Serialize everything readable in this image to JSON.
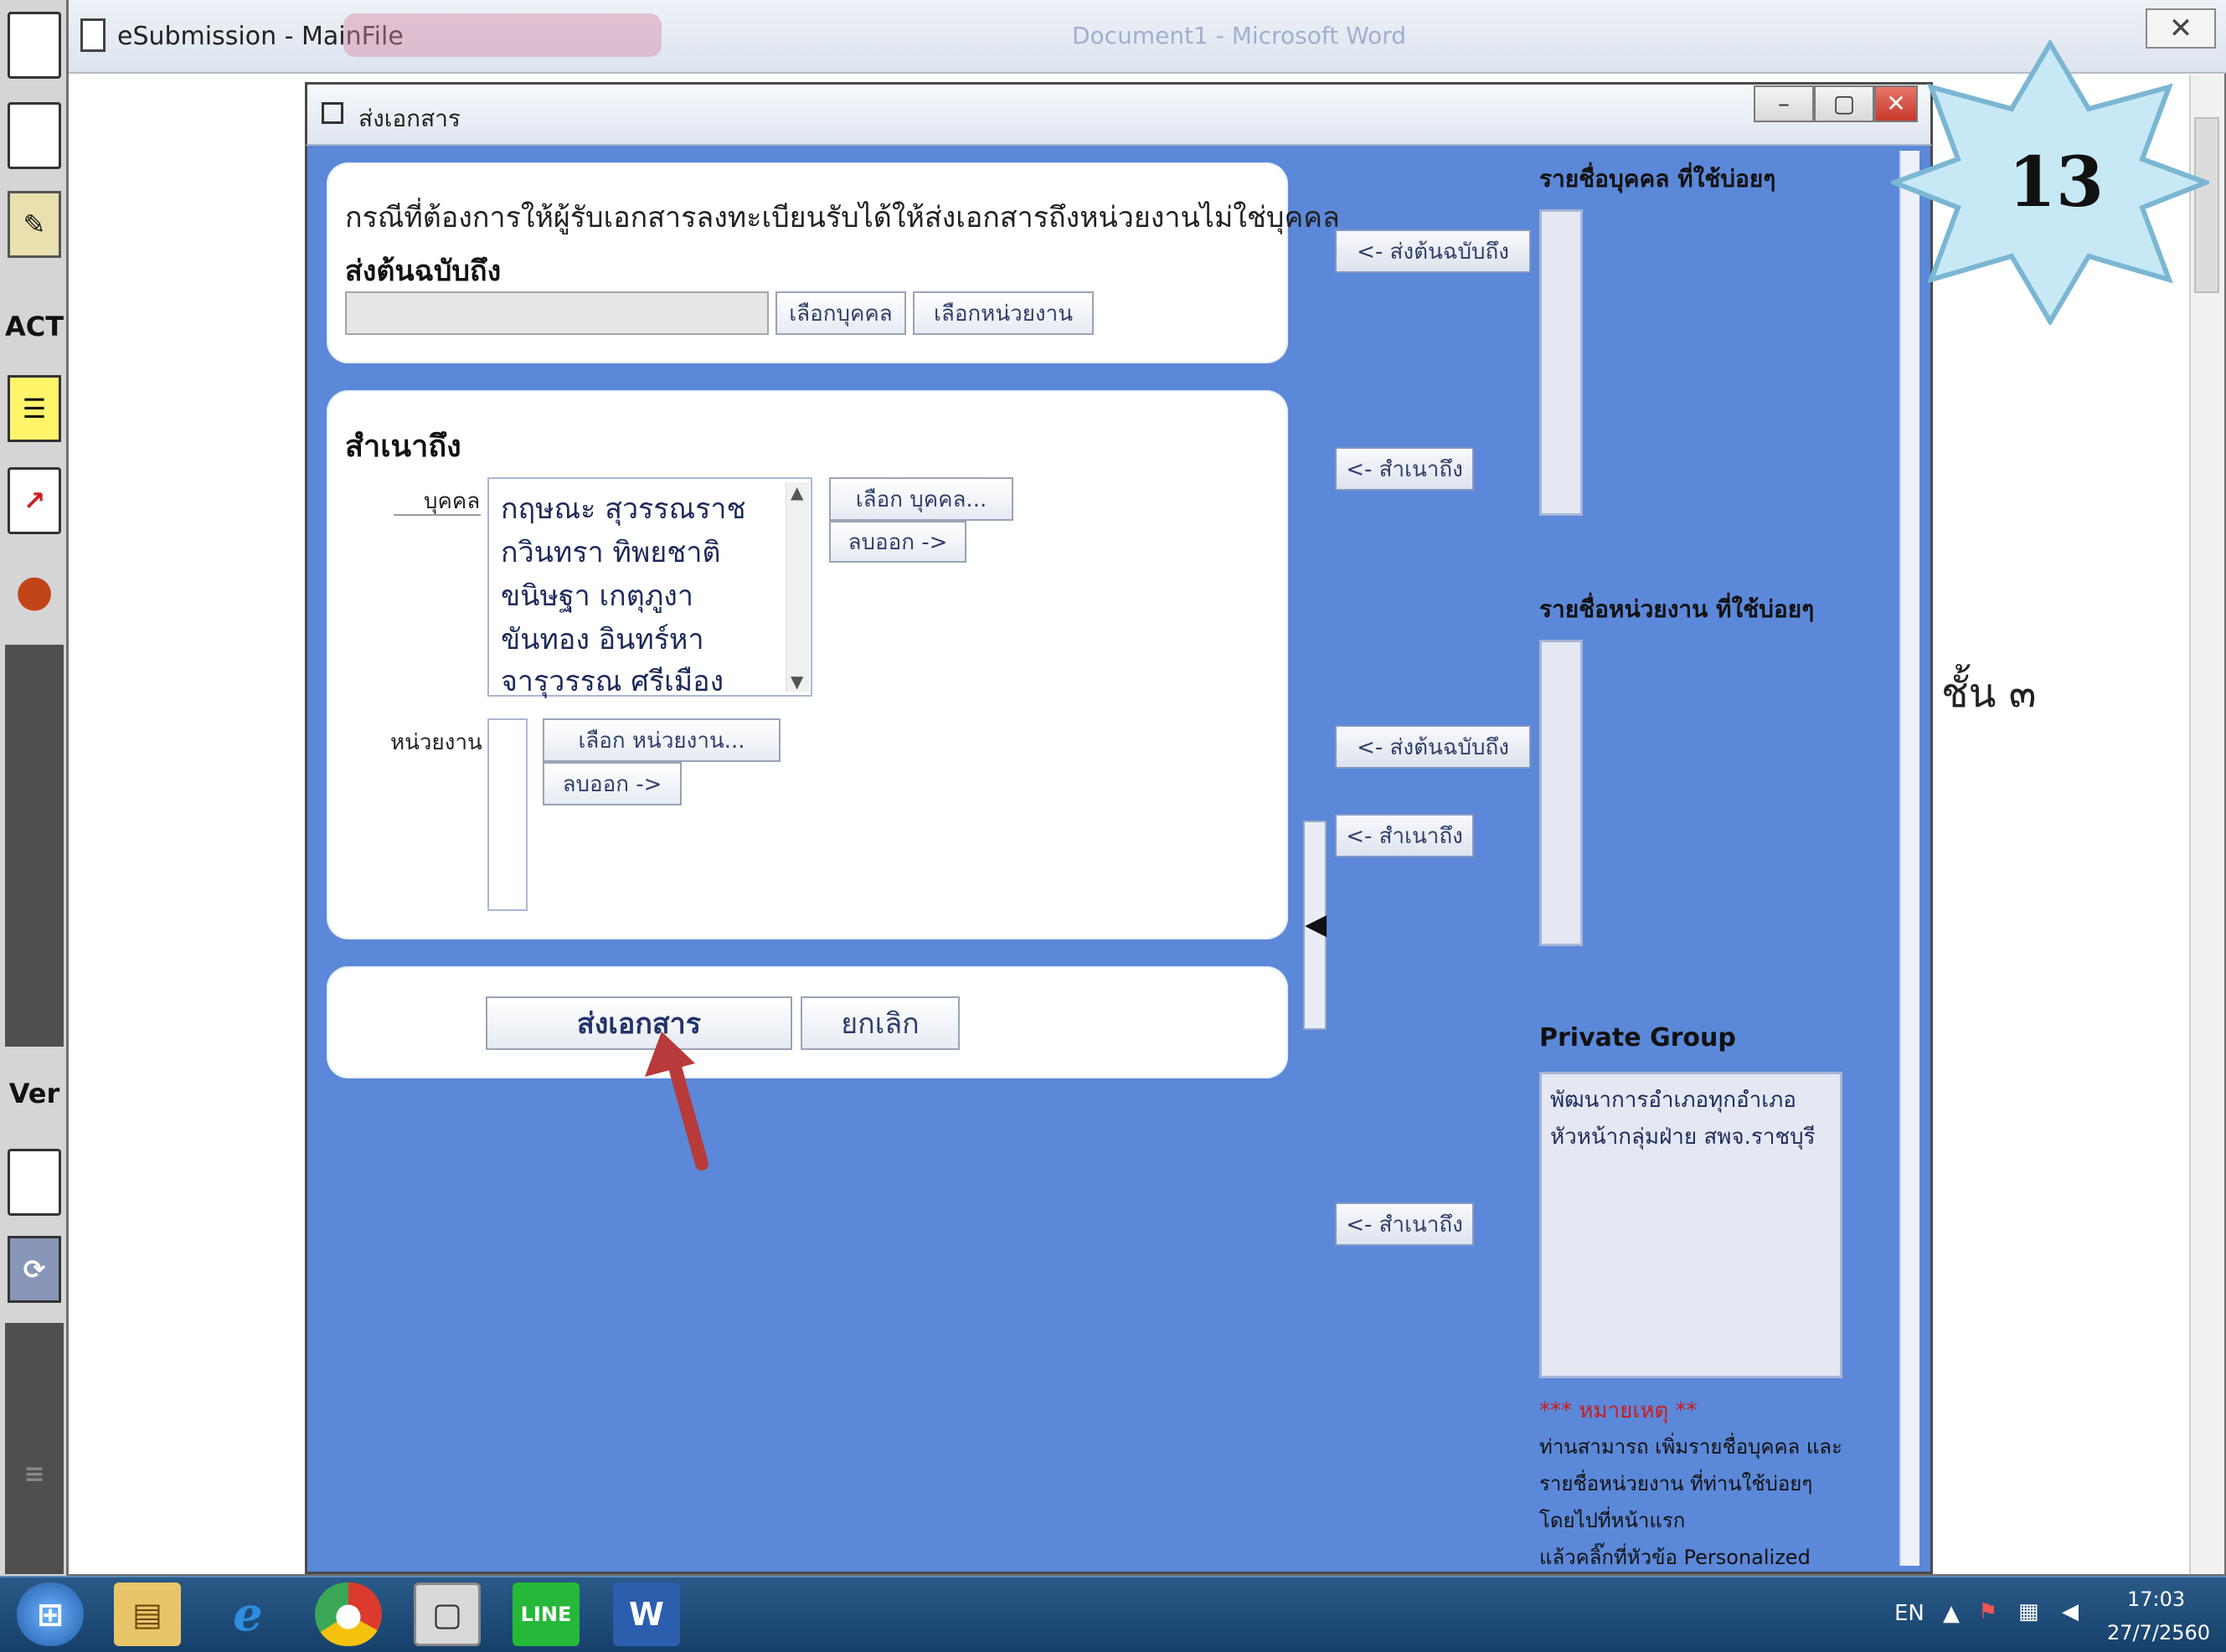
{
  "app": {
    "title": "eSubmission - MainFile",
    "background_title": "Document1 - Microsoft Word"
  },
  "toolbar": {
    "act_label": "ACT",
    "ver_label": "Ver"
  },
  "behind_doc": {
    "floor_text": "ชั้น ๓"
  },
  "dialog": {
    "title": "ส่งเอกสาร",
    "note": "กรณีที่ต้องการให้ผู้รับเอกสารลงทะเบียนรับได้ให้ส่งเอกสารถึงหน่วยงานไม่ใช่บุคคล",
    "original_to": {
      "heading": "ส่งต้นฉบับถึง",
      "field_value": "",
      "select_person_label": "เลือกบุคคล",
      "select_unit_label": "เลือกหน่วยงาน"
    },
    "copy_to": {
      "heading": "สำเนาถึง",
      "person_label": "บุคคล",
      "persons": [
        "กฤษณะ  สุวรรณราช",
        "กวินทรา  ทิพยชาติ",
        "ขนิษฐา  เกตุภูงา",
        "ขันทอง  อินทร์หา",
        "จารุวรรณ  ศรีเมือง"
      ],
      "select_person_label": "เลือก  บุคคล...",
      "remove_person_label": "ลบออก  ->",
      "unit_label": "หน่วยงาน",
      "select_unit_label": "เลือก  หน่วยงาน...",
      "remove_unit_label": "ลบออก  ->"
    },
    "actions": {
      "send_label": "ส่งเอกสาร",
      "cancel_label": "ยกเลิก"
    },
    "side": {
      "to_original_label": "<- ส่งต้นฉบับถึง",
      "to_copy_label": "<- สำเนาถึง",
      "frequent_persons_heading": "รายชื่อบุคคล  ที่ใช้บ่อยๆ",
      "frequent_units_heading": "รายชื่อหน่วยงาน  ที่ใช้บ่อยๆ",
      "private_group_heading": "Private Group",
      "private_groups": [
        "พัฒนาการอำเภอทุกอำเภอ",
        "หัวหน้ากลุ่มฝ่าย  สพจ.ราชบุรี"
      ],
      "remark_title": "*** หมายเหตุ  **",
      "remark_lines": [
        "ท่านสามารถ  เพิ่มรายชื่อบุคคล  และ",
        "รายชื่อหน่วยงาน  ที่ท่านใช้บ่อยๆ",
        "โดยไปที่หน้าแรก",
        "แล้วคลิ๊กที่หัวข้อ  Personalized"
      ]
    }
  },
  "badge": {
    "number": "13"
  },
  "taskbar": {
    "lang": "EN",
    "time": "17:03",
    "date": "27/7/2560"
  },
  "colors": {
    "dialog_bg": "#5b88d8",
    "remark_red": "#cc1b1b",
    "arrow": "#b83a3a"
  }
}
